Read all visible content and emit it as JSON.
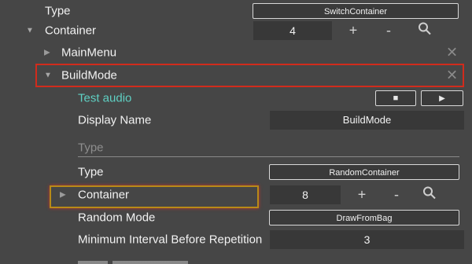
{
  "rows": {
    "type_top": {
      "label": "Type",
      "value": "SwitchContainer"
    },
    "container_top": {
      "label": "Container",
      "count": "4",
      "plus": "+",
      "minus": "-"
    },
    "mainmenu": {
      "label": "MainMenu",
      "close": "✕"
    },
    "buildmode": {
      "label": "BuildMode",
      "close": "✕"
    },
    "test_audio": {
      "label": "Test audio",
      "stop": "■",
      "play": "▶"
    },
    "display_name": {
      "label": "Display Name",
      "value": "BuildMode"
    },
    "type_section": {
      "label": "Type"
    },
    "type_inner": {
      "label": "Type",
      "value": "RandomContainer"
    },
    "container_inner": {
      "label": "Container",
      "count": "8",
      "plus": "+",
      "minus": "-"
    },
    "random_mode": {
      "label": "Random Mode",
      "value": "DrawFromBag"
    },
    "min_interval": {
      "label": "Minimum Interval Before Repetition",
      "value": "3"
    }
  },
  "colors": {
    "background": "#464646",
    "teal_label": "#5fd0c3",
    "highlight_red": "#d12b1c",
    "highlight_yellow": "#b98a17"
  }
}
